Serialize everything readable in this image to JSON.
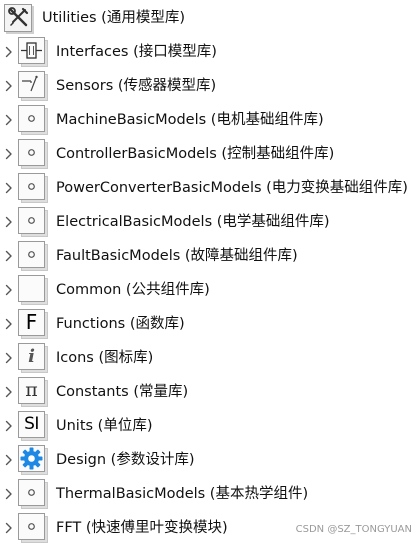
{
  "root": {
    "label": "Utilities (通用模型库)",
    "icon": "wrench-screwdriver-icon"
  },
  "items": [
    {
      "label": "Interfaces (接口模型库)",
      "icon": "connector-icon"
    },
    {
      "label": "Sensors (传感器模型库)",
      "icon": "sensor-icon"
    },
    {
      "label": "MachineBasicModels (电机基础组件库)",
      "icon": "circle-icon"
    },
    {
      "label": "ControllerBasicModels (控制基础组件库)",
      "icon": "circle-icon"
    },
    {
      "label": "PowerConverterBasicModels (电力变换基础组件库)",
      "icon": "circle-icon"
    },
    {
      "label": "ElectricalBasicModels (电学基础组件库)",
      "icon": "circle-icon"
    },
    {
      "label": "FaultBasicModels (故障基础组件库)",
      "icon": "circle-icon"
    },
    {
      "label": "Common (公共组件库)",
      "icon": "blank-icon"
    },
    {
      "label": "Functions (函数库)",
      "icon": "letter-f-icon",
      "glyph": "F"
    },
    {
      "label": "Icons (图标库)",
      "icon": "info-i-icon",
      "glyph": "i"
    },
    {
      "label": "Constants (常量库)",
      "icon": "pi-icon",
      "glyph": "π"
    },
    {
      "label": "Units (单位库)",
      "icon": "si-icon",
      "glyph": "SI"
    },
    {
      "label": "Design (参数设计库)",
      "icon": "gear-icon"
    },
    {
      "label": "ThermalBasicModels (基本热学组件)",
      "icon": "circle-icon"
    },
    {
      "label": "FFT (快速傅里叶变换模块)",
      "icon": "circle-icon"
    }
  ],
  "watermark": "CSDN @SZ_TONGYUAN",
  "colors": {
    "gear": "#1e88e5",
    "chevron": "#555555",
    "icon_border": "#9a9a9a"
  }
}
